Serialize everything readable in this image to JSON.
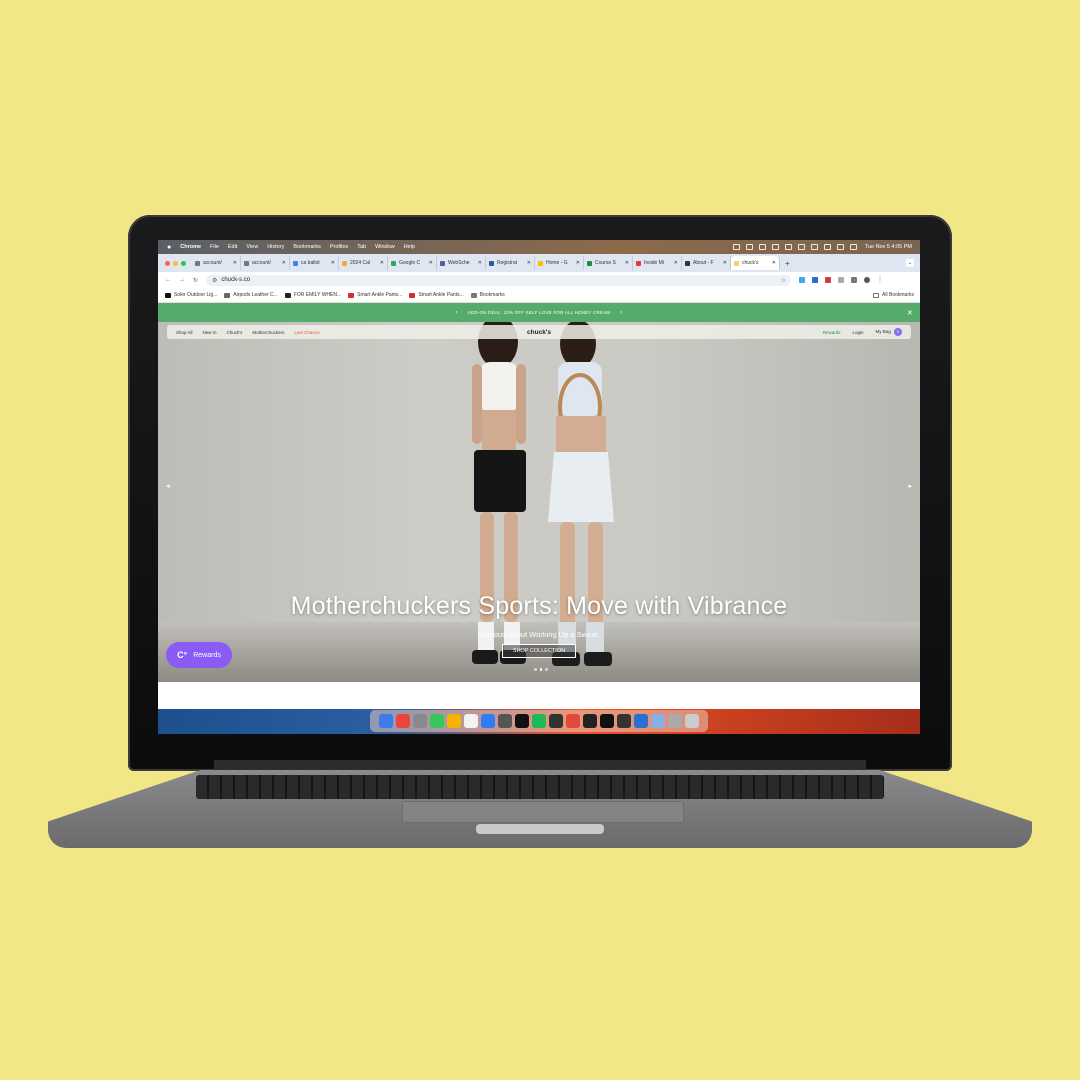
{
  "menubar": {
    "apple": "",
    "app": "Chrome",
    "items": [
      "File",
      "Edit",
      "View",
      "History",
      "Bookmarks",
      "Profiles",
      "Tab",
      "Window",
      "Help"
    ],
    "clock": "Tue Nov 5  4:05 PM"
  },
  "tabs": [
    {
      "label": "account/",
      "fav": "#777"
    },
    {
      "label": "account/",
      "fav": "#777"
    },
    {
      "label": "ca ballot",
      "fav": "#4285f4"
    },
    {
      "label": "2024 Cal",
      "fav": "#f2a93b"
    },
    {
      "label": "Google C",
      "fav": "#34a853"
    },
    {
      "label": "WebSche",
      "fav": "#5a5a9a"
    },
    {
      "label": "Registrat",
      "fav": "#2b5aa8"
    },
    {
      "label": "Home - G",
      "fav": "#fbbc05"
    },
    {
      "label": "Course S",
      "fav": "#1e8e3e"
    },
    {
      "label": "Inside Mi",
      "fav": "#e53935"
    },
    {
      "label": "About - F",
      "fav": "#333"
    },
    {
      "label": "chuck's",
      "fav": "#f2d36b",
      "active": true
    }
  ],
  "toolbar": {
    "url": "chuck-s.co"
  },
  "bookmarks": [
    {
      "label": "Soler Outdoor Lig...",
      "color": "#111"
    },
    {
      "label": "Airpods Leather C...",
      "color": "#666"
    },
    {
      "label": "FOR EMILY WHEN...",
      "color": "#222"
    },
    {
      "label": "Smart Ankle Pants...",
      "color": "#d32f2f"
    },
    {
      "label": "Smart Ankle Pants...",
      "color": "#d32f2f"
    },
    {
      "label": "Bookmarks",
      "color": "#777"
    }
  ],
  "bookmarks_all": "All Bookmarks",
  "promo": {
    "text": "ADD-ON DEAL: 10% OFF SELF LOVE FOR ALL HONEY CREAM",
    "prev": "‹",
    "next": "›",
    "close": "✕"
  },
  "sitenav": {
    "links": [
      "Shop All",
      "New In",
      "Chuck's",
      "Motherchuckers"
    ],
    "last_chance": "Last Chance",
    "brand": "chuck's",
    "rewards": "Rewards",
    "login": "Login",
    "bag": "My Bag",
    "bag_count": "0"
  },
  "hero": {
    "headline": "Motherchuckers Sports: Move with Vibrance",
    "subline": "Serious About Working Up a Sweat",
    "cta": "SHOP COLLECTION",
    "slides": 3,
    "active_slide": 2
  },
  "rewards_widget": {
    "logo": "C°",
    "label": "Rewards",
    "color": "#8a5cf5"
  },
  "dock_colors": [
    "#3d7be8",
    "#e9453a",
    "#8a8a8a",
    "#35c759",
    "#f5b400",
    "#f2f2f2",
    "#2f7cf6",
    "#555",
    "#111",
    "#1db954",
    "#333",
    "#e04a3a",
    "#222",
    "#111",
    "#333",
    "#2a6fd6",
    "#89b0e0",
    "#aaa",
    "#ccc"
  ]
}
